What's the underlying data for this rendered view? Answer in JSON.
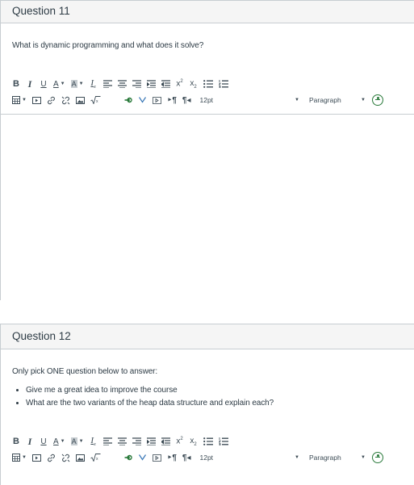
{
  "q11": {
    "title": "Question 11",
    "text": "What is dynamic programming and what does it solve?",
    "font_size": "12pt",
    "block_format": "Paragraph"
  },
  "q12": {
    "title": "Question 12",
    "text": "Only pick ONE question below to answer:",
    "options": [
      "Give me a great idea to improve the course",
      "What are the two variants of the heap data structure and explain each?"
    ],
    "font_size": "12pt",
    "block_format": "Paragraph"
  },
  "toolbar": {
    "bold": "B",
    "italic": "I",
    "underline": "U",
    "text_color": "A",
    "highlight": "A",
    "clear_format": "Ix",
    "superscript": "x²",
    "subscript": "x₂"
  },
  "colors": {
    "header_bg": "#f5f5f5",
    "border": "#c7cdd1",
    "text": "#2d3b45",
    "accessibility_green": "#2a7a3b"
  }
}
